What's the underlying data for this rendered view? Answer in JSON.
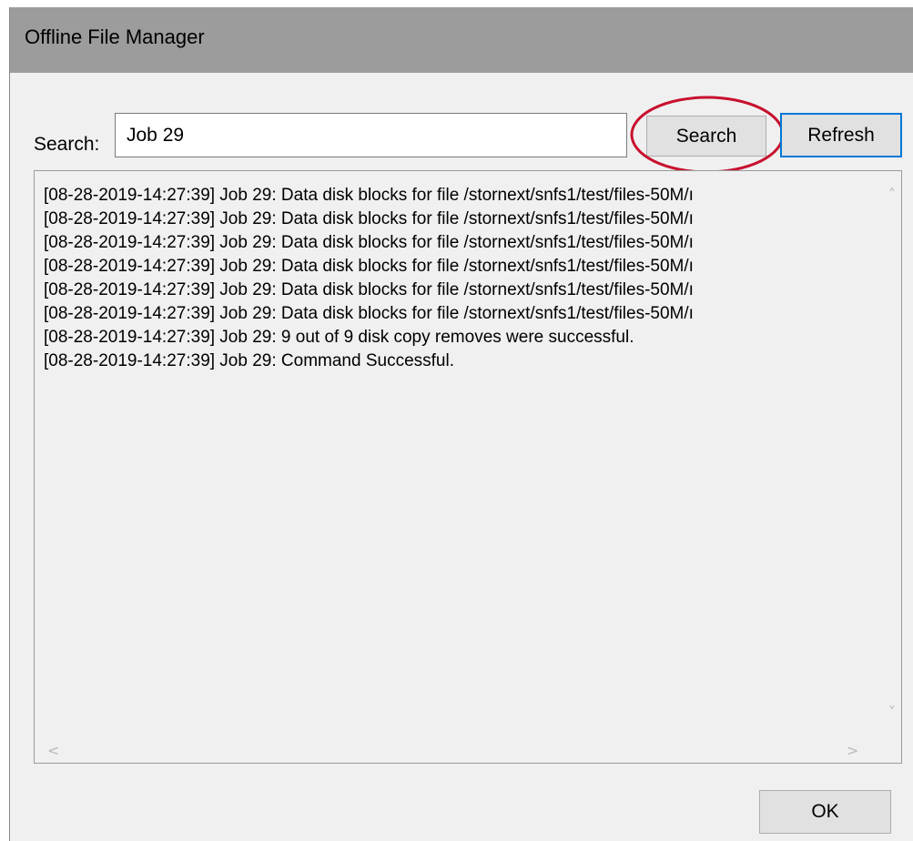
{
  "window": {
    "title": "Offline File Manager"
  },
  "search": {
    "label": "Search:",
    "value": "Job 29"
  },
  "buttons": {
    "search": "Search",
    "refresh": "Refresh",
    "ok": "OK"
  },
  "log": {
    "lines": [
      "[08-28-2019-14:27:39] Job 29: Data disk blocks for file /stornext/snfs1/test/files-50M/ı",
      "[08-28-2019-14:27:39] Job 29: Data disk blocks for file /stornext/snfs1/test/files-50M/ı",
      "[08-28-2019-14:27:39] Job 29: Data disk blocks for file /stornext/snfs1/test/files-50M/ı",
      "[08-28-2019-14:27:39] Job 29: Data disk blocks for file /stornext/snfs1/test/files-50M/ı",
      "[08-28-2019-14:27:39] Job 29: Data disk blocks for file /stornext/snfs1/test/files-50M/ı",
      "[08-28-2019-14:27:39] Job 29: Data disk blocks for file /stornext/snfs1/test/files-50M/ı",
      "[08-28-2019-14:27:39] Job 29: 9 out of 9 disk copy removes were successful.",
      "[08-28-2019-14:27:39] Job 29: Command Successful."
    ]
  },
  "colors": {
    "titlebar": "#9c9c9c",
    "highlight": "#c8102e",
    "focus_border": "#0078d7"
  },
  "icons": {
    "scroll_up": "˄",
    "scroll_down": "˅",
    "scroll_left": "<",
    "scroll_right": ">"
  }
}
